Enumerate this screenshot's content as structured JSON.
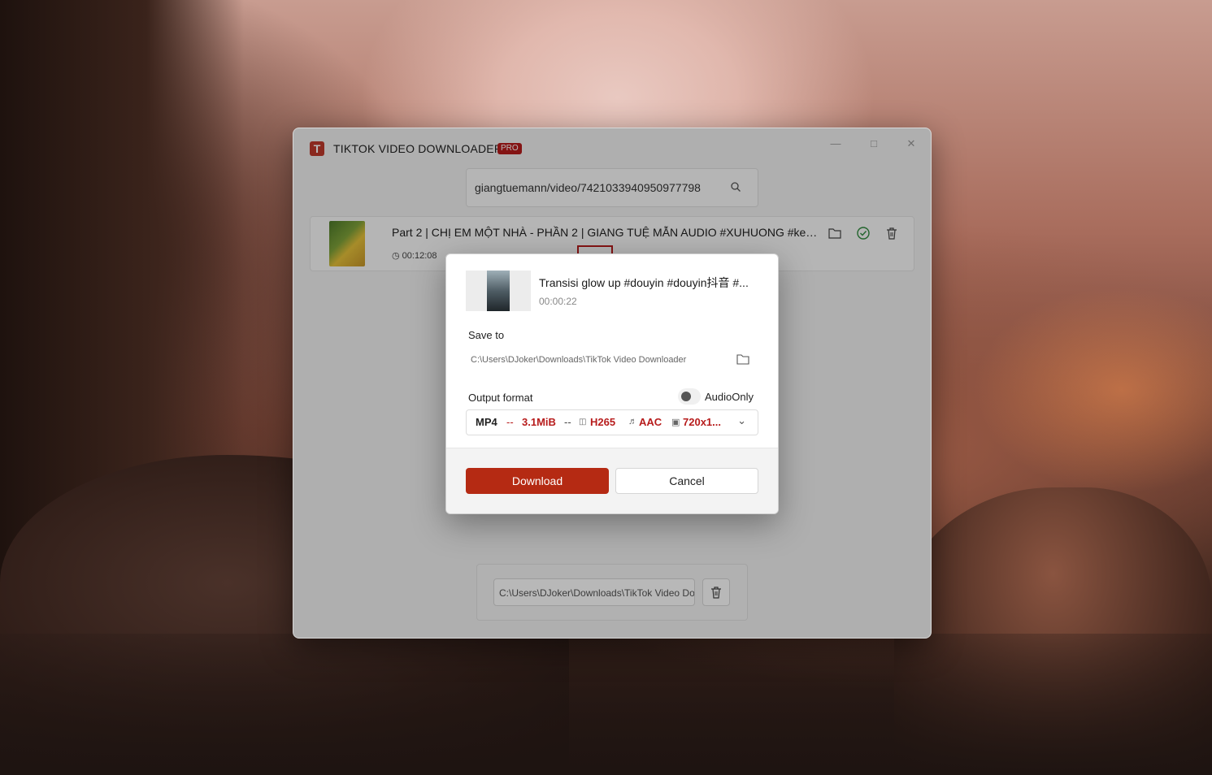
{
  "app": {
    "title": "TIKTOK VIDEO DOWNLOADER",
    "badge": "PRO",
    "logo_letter": "T",
    "accent_color": "#b52a13"
  },
  "search": {
    "value": "giangtuemann/video/7421033940950977798",
    "icon": "search-icon"
  },
  "video_item": {
    "title": "Part 2 | CHỊ EM MỘT NHÀ - PHẦN 2 | GIANG TUỆ MẪN AUDIO #XUHUONG #kec...",
    "duration": "00:12:08",
    "actions": [
      "folder-icon",
      "check-circle-icon",
      "trash-icon"
    ]
  },
  "bottom": {
    "path": "C:\\Users\\DJoker\\Downloads\\TikTok Video Downloader"
  },
  "dialog": {
    "title": "Transisi glow up #douyin #douyin抖音 #...",
    "duration": "00:00:22",
    "save_to_label": "Save to",
    "save_path": "C:\\Users\\DJoker\\Downloads\\TikTok Video Downloader",
    "output_format_label": "Output format",
    "audio_only_label": "AudioOnly",
    "audio_only": false,
    "format": {
      "container": "MP4",
      "sep": "--",
      "size": "3.1MiB",
      "video_codec": "H265",
      "audio_codec": "AAC",
      "resolution": "720x1..."
    },
    "download_label": "Download",
    "cancel_label": "Cancel"
  }
}
